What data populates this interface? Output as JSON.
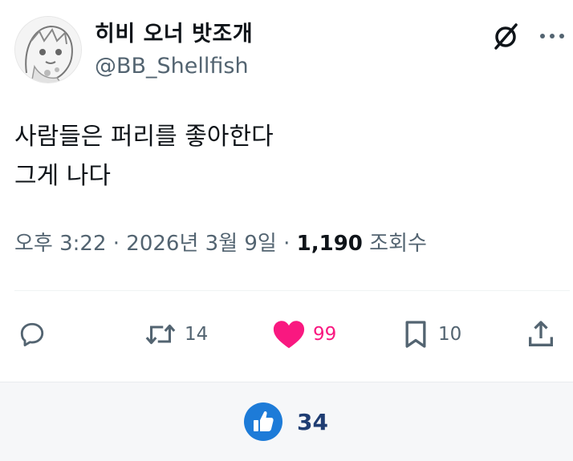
{
  "tweet": {
    "author": {
      "display_name": "히비 오너 밧조개",
      "handle": "@BB_Shellfish"
    },
    "text_lines": [
      "사람들은 퍼리를 좋아한다",
      "그게 나다"
    ],
    "meta": {
      "time": "오후 3:22",
      "separator": "·",
      "date": "2026년 3월 9일",
      "views": "1,190",
      "views_label": "조회수"
    },
    "actions": {
      "reply_icon": "reply-icon",
      "retweet_icon": "retweet-icon",
      "retweet_count": "14",
      "like_icon": "heart-icon",
      "like_count": "99",
      "like_color": "#f91880",
      "bookmark_icon": "bookmark-icon",
      "bookmark_count": "10",
      "share_icon": "share-icon"
    }
  },
  "bottom_bar": {
    "thumb_icon": "thumbs-up-icon",
    "thumb_count": "34",
    "thumb_color": "#1d7bd8"
  }
}
